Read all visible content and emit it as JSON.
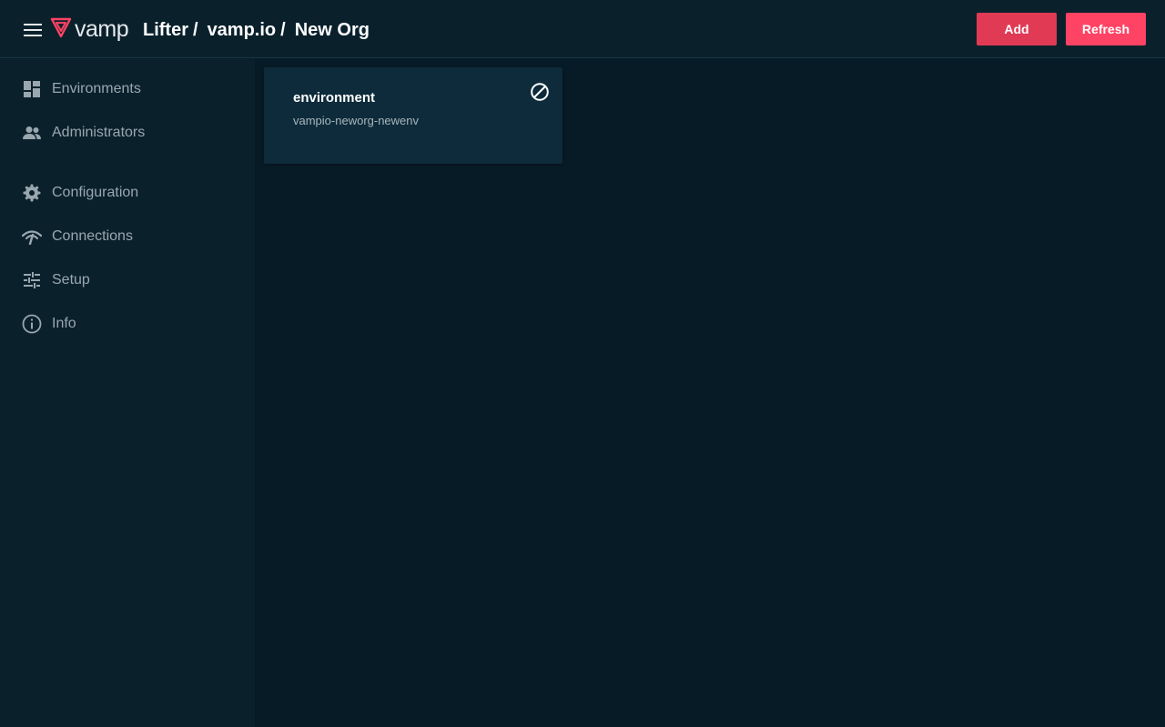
{
  "header": {
    "menu_icon": "hamburger-menu-icon",
    "logo": {
      "icon": "vamp-logo-icon",
      "text": "vamp",
      "color": "#ff4364"
    },
    "breadcrumb": [
      {
        "label": "Lifter"
      },
      {
        "label": "vamp.io"
      },
      {
        "label": "New Org"
      }
    ],
    "separator": "/",
    "actions": {
      "add_label": "Add",
      "refresh_label": "Refresh"
    }
  },
  "sidebar": {
    "items": [
      {
        "label": "Environments",
        "icon": "dashboard-icon"
      },
      {
        "label": "Administrators",
        "icon": "people-icon"
      },
      {
        "label": "Configuration",
        "icon": "gear-icon"
      },
      {
        "label": "Connections",
        "icon": "signal-icon"
      },
      {
        "label": "Setup",
        "icon": "sliders-icon"
      },
      {
        "label": "Info",
        "icon": "info-icon"
      }
    ]
  },
  "main": {
    "cards": [
      {
        "title": "environment",
        "subtitle": "vampio-neworg-newenv",
        "action_icon": "block-icon"
      }
    ]
  },
  "colors": {
    "accent": "#ff4364",
    "add_button": "#e03a54",
    "background": "#071b26",
    "surface": "#0a212c",
    "card": "#0d2b3a",
    "nav_text": "#9aa7af"
  }
}
